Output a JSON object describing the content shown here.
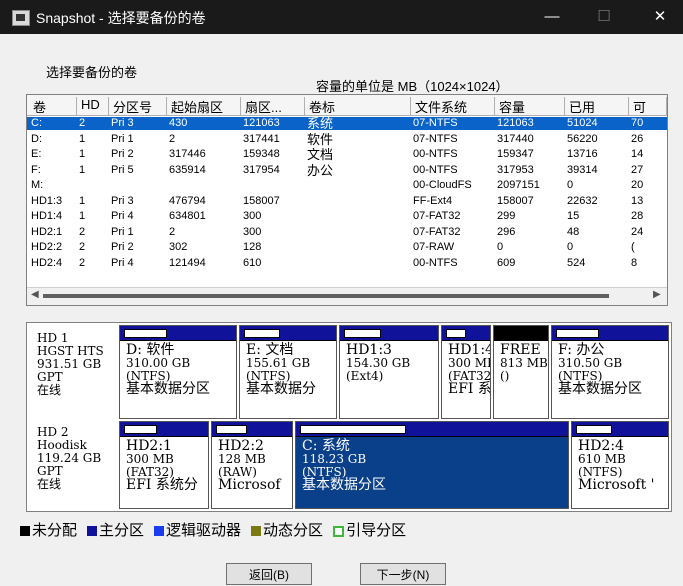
{
  "window": {
    "title": "Snapshot - 选择要备份的卷",
    "minimize": "—",
    "maximize": "☐",
    "close": "✕"
  },
  "labels": {
    "select_volume": "选择要备份的卷",
    "unit_note": "容量的单位是 MB（1024×1024）"
  },
  "table": {
    "headers": [
      "卷",
      "HD",
      "分区号",
      "起始扇区",
      "扇区...",
      "卷标",
      "文件系统",
      "容量",
      "已用",
      "可"
    ],
    "rows": [
      [
        "C:",
        "2",
        "Pri 3",
        "430",
        "121063",
        "系统",
        "07-NTFS",
        "121063",
        "51024",
        "70"
      ],
      [
        "D:",
        "1",
        "Pri 1",
        "2",
        "317441",
        "软件",
        "07-NTFS",
        "317440",
        "56220",
        "26"
      ],
      [
        "E:",
        "1",
        "Pri 2",
        "317446",
        "159348",
        "文档",
        "00-NTFS",
        "159347",
        "13716",
        "14"
      ],
      [
        "F:",
        "1",
        "Pri 5",
        "635914",
        "317954",
        "办公",
        "00-NTFS",
        "317953",
        "39314",
        "27"
      ],
      [
        "M:",
        "",
        "",
        "",
        "",
        "",
        "00-CloudFS",
        "2097151",
        "0",
        "20"
      ],
      [
        "HD1:3",
        "1",
        "Pri 3",
        "476794",
        "158007",
        "",
        "FF-Ext4",
        "158007",
        "22632",
        "13"
      ],
      [
        "HD1:4",
        "1",
        "Pri 4",
        "634801",
        "300",
        "",
        "07-FAT32",
        "299",
        "15",
        "28"
      ],
      [
        "HD2:1",
        "2",
        "Pri 1",
        "2",
        "300",
        "",
        "07-FAT32",
        "296",
        "48",
        "24"
      ],
      [
        "HD2:2",
        "2",
        "Pri 2",
        "302",
        "128",
        "",
        "07-RAW",
        "0",
        "0",
        "("
      ],
      [
        "HD2:4",
        "2",
        "Pri 4",
        "121494",
        "610",
        "",
        "00-NTFS",
        "609",
        "524",
        "8"
      ]
    ],
    "selected_row": 0
  },
  "disks": [
    {
      "info": [
        "HD 1",
        "HGST HTS",
        "931.51 GB",
        "GPT",
        "在线"
      ],
      "partitions": [
        {
          "lines": [
            "D: 软件",
            "310.00 GB",
            "(NTFS)",
            "基本数据分区"
          ],
          "type": "primary"
        },
        {
          "lines": [
            "E: 文档",
            "155.61 GB",
            "(NTFS)",
            "基本数据分"
          ],
          "type": "primary"
        },
        {
          "lines": [
            "HD1:3",
            "154.30 GB",
            "(Ext4)"
          ],
          "type": "primary"
        },
        {
          "lines": [
            "HD1:4",
            "300 MB",
            "(FAT32)",
            "EFI 系"
          ],
          "type": "primary"
        },
        {
          "lines": [
            "FREE",
            "813 MB",
            "()"
          ],
          "type": "unallocated"
        },
        {
          "lines": [
            "F: 办公",
            "310.50 GB",
            "(NTFS)",
            "基本数据分区"
          ],
          "type": "primary"
        }
      ]
    },
    {
      "info": [
        "HD 2",
        "Hoodisk",
        "119.24 GB",
        "GPT",
        "在线"
      ],
      "partitions": [
        {
          "lines": [
            "HD2:1",
            "300 MB",
            "(FAT32)",
            "EFI 系统分"
          ],
          "type": "primary"
        },
        {
          "lines": [
            "HD2:2",
            "128 MB",
            "(RAW)",
            "Microsof"
          ],
          "type": "primary"
        },
        {
          "lines": [
            "C: 系统",
            "118.23 GB",
            "(NTFS)",
            "基本数据分区"
          ],
          "type": "primary",
          "selected": true
        },
        {
          "lines": [
            "HD2:4",
            "610 MB",
            "(NTFS)",
            "Microsoft '"
          ],
          "type": "primary"
        }
      ]
    }
  ],
  "legend": [
    {
      "label": "未分配",
      "color": "#000000"
    },
    {
      "label": "主分区",
      "color": "#10129a"
    },
    {
      "label": "逻辑驱动器",
      "color": "#1a3cf0"
    },
    {
      "label": "动态分区",
      "color": "#7a7a10"
    },
    {
      "label": "引导分区",
      "color": "#3cb83c"
    }
  ],
  "buttons": {
    "back": "返回(B)",
    "next": "下一步(N)"
  }
}
